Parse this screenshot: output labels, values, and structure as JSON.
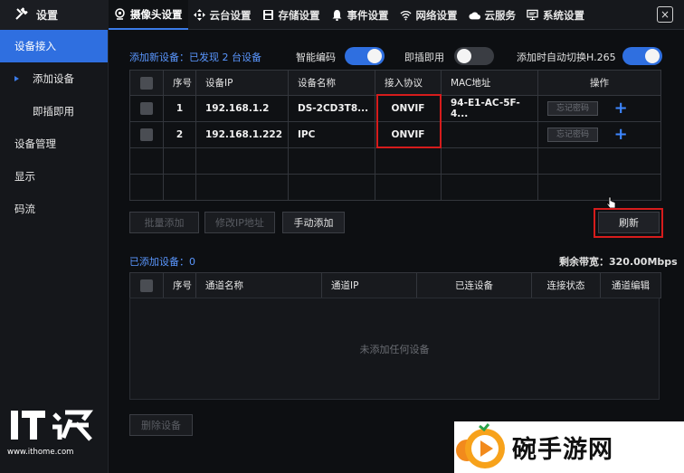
{
  "app": {
    "title": "设置",
    "close_symbol": "×"
  },
  "tabs": [
    {
      "label": "摄像头设置",
      "icon": "camera-icon",
      "active": true
    },
    {
      "label": "云台设置",
      "icon": "ptz-icon",
      "active": false
    },
    {
      "label": "存储设置",
      "icon": "storage-icon",
      "active": false
    },
    {
      "label": "事件设置",
      "icon": "bell-icon",
      "active": false
    },
    {
      "label": "网络设置",
      "icon": "wifi-icon",
      "active": false
    },
    {
      "label": "云服务",
      "icon": "cloud-icon",
      "active": false
    },
    {
      "label": "系统设置",
      "icon": "monitor-icon",
      "active": false
    }
  ],
  "sidebar": {
    "items": [
      {
        "label": "设备接入",
        "active": true
      },
      {
        "label": "添加设备",
        "sub": true,
        "current": true
      },
      {
        "label": "即插即用",
        "sub": true
      },
      {
        "label": "设备管理"
      },
      {
        "label": "显示"
      },
      {
        "label": "码流"
      }
    ]
  },
  "options": {
    "discovered": "添加新设备：已发现 2 台设备",
    "smart_encode": {
      "label": "智能编码",
      "on": true
    },
    "plug_play": {
      "label": "即插即用",
      "on": false
    },
    "auto_h265": {
      "label": "添加时自动切换H.265",
      "on": true
    }
  },
  "device_table": {
    "headers": [
      "序号",
      "设备IP",
      "设备名称",
      "接入协议",
      "MAC地址",
      "操作"
    ],
    "rows": [
      {
        "no": "1",
        "ip": "192.168.1.2",
        "name": "DS-2CD3T8...",
        "protocol": "ONVIF",
        "mac": "94-E1-AC-5F-4...",
        "action": "忘记密码"
      },
      {
        "no": "2",
        "ip": "192.168.1.222",
        "name": "IPC",
        "protocol": "ONVIF",
        "mac": "",
        "action": "忘记密码"
      }
    ]
  },
  "buttons": {
    "batch_add": "批量添加",
    "modify_ip": "修改IP地址",
    "manual_add": "手动添加",
    "refresh": "刷新",
    "delete": "删除设备"
  },
  "added": {
    "title": "已添加设备：0",
    "bandwidth": "剩余带宽：320.00Mbps",
    "headers": [
      "序号",
      "通道名称",
      "通道IP",
      "已连设备",
      "连接状态",
      "通道编辑"
    ],
    "empty": "未添加任何设备"
  },
  "watermarks": {
    "ithome_logo": "IT之家",
    "ithome_url": "www.ithome.com",
    "site": "碗手游网"
  }
}
